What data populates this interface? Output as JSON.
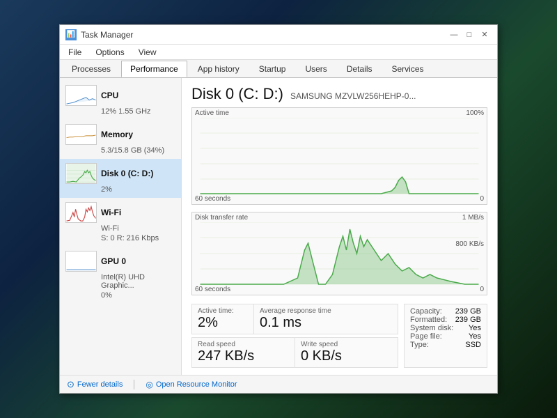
{
  "window": {
    "title": "Task Manager",
    "icon": "📊"
  },
  "window_controls": {
    "minimize": "—",
    "maximize": "□",
    "close": "✕"
  },
  "menu": {
    "items": [
      "File",
      "Options",
      "View"
    ]
  },
  "tabs": [
    {
      "id": "processes",
      "label": "Processes"
    },
    {
      "id": "performance",
      "label": "Performance",
      "active": true
    },
    {
      "id": "app_history",
      "label": "App history"
    },
    {
      "id": "startup",
      "label": "Startup"
    },
    {
      "id": "users",
      "label": "Users"
    },
    {
      "id": "details",
      "label": "Details"
    },
    {
      "id": "services",
      "label": "Services"
    }
  ],
  "sidebar": {
    "items": [
      {
        "id": "cpu",
        "name": "CPU",
        "sub": "12% 1.55 GHz",
        "type": "cpu"
      },
      {
        "id": "memory",
        "name": "Memory",
        "sub": "5.3/15.8 GB (34%)",
        "type": "memory"
      },
      {
        "id": "disk0",
        "name": "Disk 0 (C: D:)",
        "sub": "2%",
        "type": "disk",
        "active": true
      },
      {
        "id": "wifi",
        "name": "Wi-Fi",
        "sub1": "Wi-Fi",
        "sub2": "S: 0  R: 216 Kbps",
        "type": "wifi"
      },
      {
        "id": "gpu0",
        "name": "GPU 0",
        "sub": "Intel(R) UHD Graphic...",
        "sub2": "0%",
        "type": "gpu"
      }
    ]
  },
  "main": {
    "title": "Disk 0 (C: D:)",
    "subtitle": "SAMSUNG MZVLW256HEHP-0...",
    "chart1": {
      "label": "Active time",
      "top_right": "100%",
      "bottom_left": "60 seconds",
      "bottom_right": "0"
    },
    "chart2": {
      "label": "Disk transfer rate",
      "top_right": "1 MB/s",
      "mid_right": "800 KB/s",
      "bottom_left": "60 seconds",
      "bottom_right": "0"
    },
    "stats": {
      "active_time_label": "Active time:",
      "active_time_value": "2%",
      "avg_response_label": "Average response time",
      "avg_response_value": "0.1 ms",
      "read_speed_label": "Read speed",
      "read_speed_value": "247 KB/s",
      "write_speed_label": "Write speed",
      "write_speed_value": "0 KB/s",
      "capacity_label": "Capacity:",
      "capacity_value": "239 GB",
      "formatted_label": "Formatted:",
      "formatted_value": "239 GB",
      "system_disk_label": "System disk:",
      "system_disk_value": "Yes",
      "page_file_label": "Page file:",
      "page_file_value": "Yes",
      "type_label": "Type:",
      "type_value": "SSD"
    }
  },
  "footer": {
    "fewer_details": "Fewer details",
    "open_resource_monitor": "Open Resource Monitor"
  }
}
